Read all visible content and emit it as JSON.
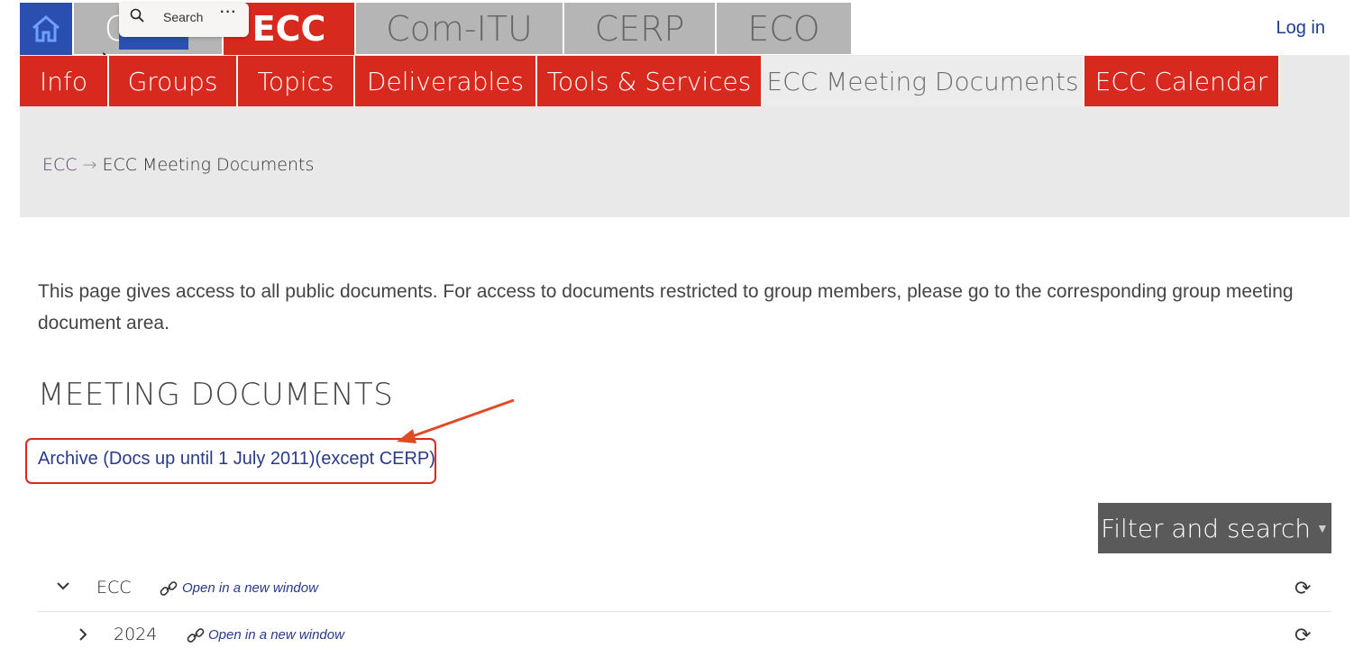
{
  "top_tabs": {
    "cept": "CEPT",
    "ecc": "ECC",
    "comitu": "Com-ITU",
    "cerp": "CERP",
    "eco": "ECO"
  },
  "login": "Log in",
  "search_popup": {
    "label": "Search",
    "more": "···"
  },
  "nav": {
    "items": [
      {
        "label": "Info"
      },
      {
        "label": "Groups"
      },
      {
        "label": "Topics"
      },
      {
        "label": "Deliverables"
      },
      {
        "label": "Tools & Services"
      },
      {
        "label": "ECC Meeting Documents"
      },
      {
        "label": "ECC Calendar"
      }
    ]
  },
  "breadcrumb": {
    "root": "ECC",
    "arrow": "→",
    "current": "ECC Meeting Documents"
  },
  "intro": "This page gives access to all public documents. For access to documents restricted to group members, please go to the corresponding group meeting document area.",
  "heading": "MEETING DOCUMENTS",
  "archive_link": "Archive (Docs up until 1 July 2011)(except CERP)",
  "filter_button": "Filter and search",
  "tree": [
    {
      "label": "ECC",
      "link": "Open in a new window",
      "expanded": true
    },
    {
      "label": "2024",
      "link": "Open in a new window",
      "expanded": false
    }
  ],
  "colors": {
    "brand_red": "#d8291f",
    "inactive_tab": "#b5b5b5",
    "link_blue": "#2a3a8a"
  }
}
